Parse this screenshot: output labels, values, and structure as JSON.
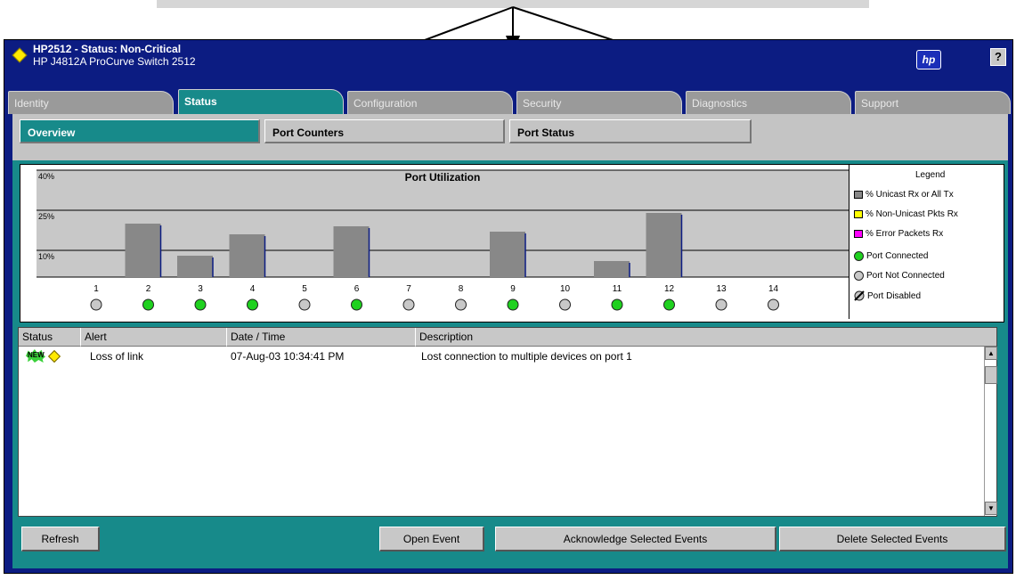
{
  "window": {
    "title": "HP2512 - Status: Non-Critical",
    "subtitle": "HP J4812A ProCurve Switch 2512",
    "help_label": "?",
    "logo_text": "hp"
  },
  "tabs": [
    {
      "label": "Identity",
      "active": false
    },
    {
      "label": "Status",
      "active": true
    },
    {
      "label": "Configuration",
      "active": false
    },
    {
      "label": "Security",
      "active": false
    },
    {
      "label": "Diagnostics",
      "active": false
    },
    {
      "label": "Support",
      "active": false
    }
  ],
  "subtabs": [
    {
      "label": "Overview",
      "active": true
    },
    {
      "label": "Port Counters",
      "active": false
    },
    {
      "label": "Port Status",
      "active": false
    }
  ],
  "chart_data": {
    "type": "bar",
    "title": "Port Utilization",
    "y_labels": [
      "40%",
      "25%",
      "10%"
    ],
    "categories": [
      "1",
      "2",
      "3",
      "4",
      "5",
      "6",
      "7",
      "8",
      "9",
      "10",
      "11",
      "12",
      "13",
      "14"
    ],
    "values": [
      0,
      20,
      8,
      16,
      0,
      19,
      0,
      0,
      17,
      0,
      6,
      24,
      0,
      0
    ],
    "ylim": [
      0,
      40
    ],
    "port_status": [
      "not-connected",
      "connected",
      "connected",
      "connected",
      "not-connected",
      "connected",
      "not-connected",
      "not-connected",
      "connected",
      "not-connected",
      "connected",
      "connected",
      "not-connected",
      "not-connected"
    ],
    "colors": {
      "bar": "#888888",
      "connected": "#1fd11f",
      "not_connected": "#c8c8c8"
    }
  },
  "legend": {
    "title": "Legend",
    "items": [
      {
        "label": "% Unicast Rx or All Tx",
        "color": "#888888",
        "kind": "swatch"
      },
      {
        "label": "% Non-Unicast Pkts Rx",
        "color": "#ffff00",
        "kind": "swatch"
      },
      {
        "label": "% Error Packets Rx",
        "color": "#ff00ff",
        "kind": "swatch"
      },
      {
        "label": "Port Connected",
        "color": "#1fd11f",
        "kind": "dot"
      },
      {
        "label": "Port Not Connected",
        "color": "#c8c8c8",
        "kind": "dot"
      },
      {
        "label": "Port Disabled",
        "color": "#c8c8c8",
        "kind": "disabled"
      }
    ]
  },
  "events": {
    "columns": [
      "Status",
      "Alert",
      "Date / Time",
      "Description"
    ],
    "rows": [
      {
        "badge": "NEW",
        "alert": "Loss of link",
        "datetime": "07-Aug-03 10:34:41 PM",
        "description": "Lost connection to multiple devices on port 1"
      }
    ]
  },
  "buttons": {
    "refresh": "Refresh",
    "open_event": "Open Event",
    "acknowledge": "Acknowledge Selected Events",
    "delete": "Delete Selected Events"
  }
}
